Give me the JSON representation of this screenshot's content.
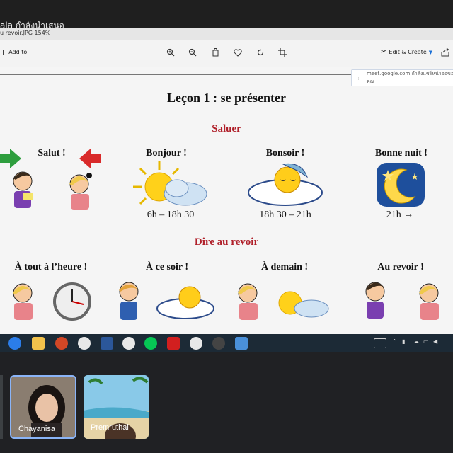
{
  "meet": {
    "presenting_text": "ala กำลังนำเสนอ",
    "popup_text": "meet.google.com กำลังแชร์หน้าจอของคุณ",
    "participants": [
      {
        "name": "Chayanisa"
      },
      {
        "name": "Premruthai"
      }
    ]
  },
  "photos_app": {
    "file_title": "u revoir.JPG   154%",
    "toolbar": {
      "add_to": "Add to",
      "edit_create": "Edit & Create"
    }
  },
  "slide": {
    "lesson_title": "Leçon 1 : se présenter",
    "section_saluer": "Saluer",
    "greetings": [
      {
        "label": "Salut !"
      },
      {
        "label": "Bonjour !",
        "time": "6h – 18h 30"
      },
      {
        "label": "Bonsoir !",
        "time": "18h 30 – 21h"
      },
      {
        "label": "Bonne nuit !",
        "time": "21h →"
      }
    ],
    "section_revoir": "Dire au revoir",
    "farewells": [
      {
        "label": "À tout à l’heure !"
      },
      {
        "label": "À ce soir !"
      },
      {
        "label": "À demain !"
      },
      {
        "label": "Au revoir !"
      }
    ]
  },
  "colors": {
    "accent_red": "#b0202a",
    "taskbar": "#1c2a36",
    "tile_border": "#8ab4f8"
  }
}
